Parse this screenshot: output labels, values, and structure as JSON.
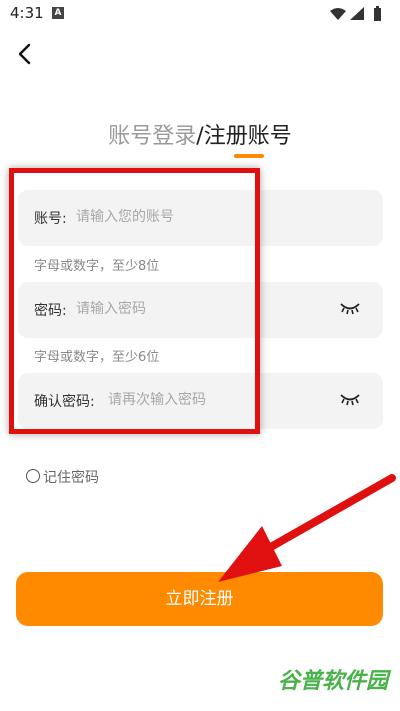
{
  "status_bar": {
    "time": "4:31",
    "notification_letter": "A"
  },
  "tabs": {
    "login": "账号登录",
    "separator": "/",
    "register": "注册账号"
  },
  "form": {
    "account": {
      "label": "账号:",
      "placeholder": "请输入您的账号",
      "hint": "字母或数字，至少8位"
    },
    "password": {
      "label": "密码:",
      "placeholder": "请输入密码",
      "hint": "字母或数字，至少6位"
    },
    "confirm": {
      "label": "确认密码:",
      "placeholder": "请再次输入密码"
    }
  },
  "remember_label": "记住密码",
  "submit_label": "立即注册",
  "watermark": "谷普软件园",
  "colors": {
    "accent": "#ff8a00",
    "annotation": "#e01010",
    "watermark": "#2aa52a"
  },
  "icons": [
    "back-arrow-icon",
    "wifi-icon",
    "signal-icon",
    "battery-icon",
    "eye-closed-icon"
  ]
}
